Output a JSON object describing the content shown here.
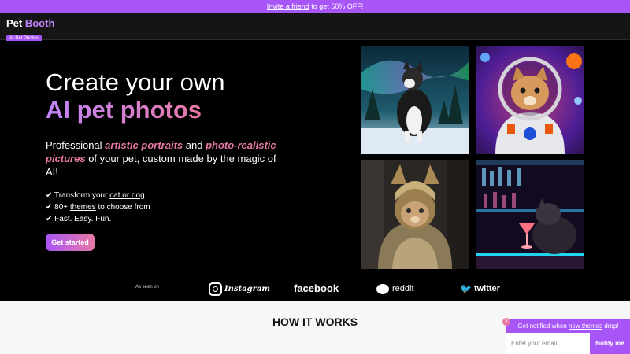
{
  "promo": {
    "link": "Invite a friend",
    "rest": " to get 50% OFF!"
  },
  "logo": {
    "part1": "Pet ",
    "part2": "Booth",
    "sub": "AI Pet Photos"
  },
  "hero": {
    "title_line1": "Create your own",
    "title_line2": "AI pet photos",
    "desc_1": "Professional ",
    "desc_em1": "artistic portraits",
    "desc_2": " and ",
    "desc_em2": "photo-realistic pictures",
    "desc_3": " of your pet, custom made by the magic of AI!",
    "b1_pre": "✔ Transform your ",
    "b1_link": "cat or dog",
    "b2_pre": "✔ 80+ ",
    "b2_link": "themes",
    "b2_post": " to choose from",
    "b3": "✔ Fast. Easy. Fun.",
    "cta": "Get started"
  },
  "seen": {
    "label": "As seen on",
    "instagram": "Instagram",
    "facebook": "facebook",
    "reddit": "reddit",
    "twitter": "twitter"
  },
  "works": {
    "title": "HOW IT WORKS"
  },
  "notify": {
    "pre": "Get notified when ",
    "link": "new themes",
    "post": " drop!",
    "placeholder": "Enter your email",
    "button": "Notify me",
    "close": "×"
  },
  "colors": {
    "accent": "#a855f7",
    "pink": "#e879a6",
    "dark": "#151515"
  }
}
